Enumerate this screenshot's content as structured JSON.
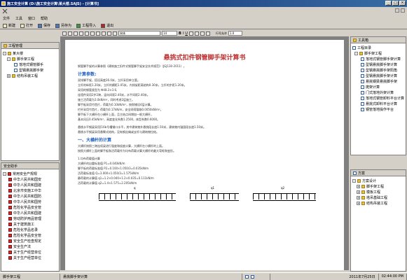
{
  "window": {
    "title": "施工安全计算 (D:\\施工安全计算\\某大楼.SAJS) - [计算书]"
  },
  "menubar": {
    "items": [
      "文件",
      "工具",
      "窗口",
      "帮助"
    ]
  },
  "toolbar": {
    "new": "新建",
    "open": "打开",
    "save": "保存",
    "save_as": "另存为",
    "import": "工程导入",
    "exit": "退出"
  },
  "left_top": {
    "header": "工程管理",
    "root": "某大楼",
    "project": "脚手架工程",
    "items": [
      "落地式钢管脚手",
      "型钢悬挑脚手架"
    ],
    "other": "结构吊装工程"
  },
  "left_bottom": {
    "header": "安全助手",
    "root": "常用安全产规规",
    "items": [
      "中华人民共和国安",
      "中华人民共和国建",
      "北京市安施工中华",
      "中华人民共和国防",
      "中华人民共和国劳",
      "危险化学品安全管",
      "中华人民共和国建",
      "劳动防护用品管理",
      "关于建筑施工",
      "危险化学品名录",
      "危险化学品安全管",
      "安全生产检查规定",
      "安全生产法",
      "关于生产经营单位",
      "关于生产经营单位"
    ]
  },
  "format_bar": {
    "font": "宋体",
    "size": "14",
    "bold": "B",
    "italic": "I",
    "underline": "U",
    "line_spacing_label": "行号允许",
    "line_spacing_value": "1.0"
  },
  "document": {
    "title": "悬挑式扣件钢管脚手架计算书",
    "intro": "钢管脚手架的计算参照《建筑施工扣件式钢管脚手架安全技术规范》（JGJ130-2011）。",
    "params_heading": "计算参数:",
    "params": [
      "双排脚手架，搭设高度26.0米，立杆采用单立管。",
      "立杆的纵距1.20米，立杆的横距1.05米，内排架距离结构0.30米，立杆的步距1.20米。",
      "采用的钢管类型为 Φ48.3×3.6,",
      "连墙件采用2步2跨，竖向间距2.40米，水平间距2.40米。",
      "施工活荷载为3.0kN/m²，同时考虑2层施工。",
      "脚手板采用竹笆片，荷载为0.10kN/m²，按照铺设4层计算。",
      "栏杆采用竹笆片，荷载为0.17kN/m，安全网荷载取0.0050kN/m²。",
      "脚手板下大横杆在小横杆上面，且主结点间增加一根大横杆。",
      "基本风压0.45kN/m²，高度变化系数1.2500，体型系数0.6000。"
    ],
    "cantilever": [
      "悬挑水平钢梁采用[16b号槽钢口水平，其中建筑物外悬挑段长度1.50米，建筑物内锚固段长度1.50米。",
      "悬挑水平钢梁采用悬臂式结构，没有钢丝绳或支杆与建筑物拉结。"
    ],
    "section1_heading": "一、大横杆的计算",
    "section1": [
      "大横杆按照三跨连续梁进行强度和挠度计算，大横杆在小横杆的上面。",
      "按照大横杆上面的脚手板和活荷载作为均布荷载计算大横杆的最大弯矩和变形。"
    ],
    "sub1_heading": "1.均布荷载值计算",
    "sub1": [
      "大横杆的自重标准值 P1=0.040kN/m",
      "脚手板的荷载标准值 P2=0.100×1.050/3=0.035kN/m",
      "活荷载标准值 Q=3.000×1.050/3=1.575kN/m",
      "静荷载的计算值 q1=1.2×0.040+1.2×0.035=0.111kN/m",
      "活荷载的计算值 q2=1.4×1.575=2.205kN/m"
    ],
    "diagram_labels": [
      "q",
      "q1",
      "q2"
    ]
  },
  "right_top": {
    "header": "工具箱",
    "root": "工程目录",
    "project": "脚手架工程",
    "items": [
      "落地式钢管脚手架计算",
      "型钢悬挑脚手架计算",
      "型钢悬挑脚手架阳角",
      "型钢悬挑脚手架计算",
      "悬挑钢梁悬挑脚手架",
      "爬架计算",
      "门式落地外架计算",
      "落地式钢管卸料平台计算",
      "悬挑式卸料平台计算",
      "钢管落地操作平台"
    ]
  },
  "right_bottom": {
    "header": "方案",
    "root": "方案设计",
    "items": [
      "脚手架工程",
      "模板工程",
      "塔吊基础工程",
      "结构吊装工程"
    ]
  },
  "status": {
    "left": "脚手架工程",
    "middle": "悬挑脚手架计算",
    "date": "2011年7月25日",
    "time": "02:44:00 PM"
  }
}
